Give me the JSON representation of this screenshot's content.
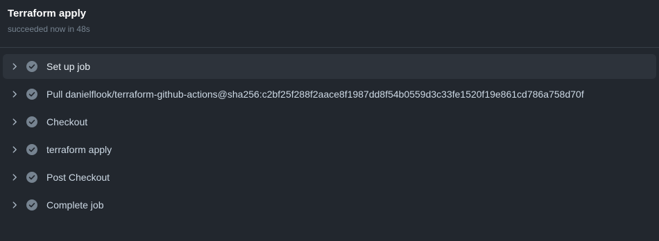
{
  "job": {
    "title": "Terraform apply",
    "status": "succeeded now in 48s"
  },
  "steps": [
    {
      "label": "Set up job",
      "status_icon": "check-circle-icon",
      "expand_icon": "chevron-right-icon"
    },
    {
      "label": "Pull danielflook/terraform-github-actions@sha256:c2bf25f288f2aace8f1987dd8f54b0559d3c33fe1520f19e861cd786a758d70f",
      "status_icon": "check-circle-icon",
      "expand_icon": "chevron-right-icon"
    },
    {
      "label": "Checkout",
      "status_icon": "check-circle-icon",
      "expand_icon": "chevron-right-icon"
    },
    {
      "label": "terraform apply",
      "status_icon": "check-circle-icon",
      "expand_icon": "chevron-right-icon"
    },
    {
      "label": "Post Checkout",
      "status_icon": "check-circle-icon",
      "expand_icon": "chevron-right-icon"
    },
    {
      "label": "Complete job",
      "status_icon": "check-circle-icon",
      "expand_icon": "chevron-right-icon"
    }
  ],
  "colors": {
    "background": "#22272e",
    "highlight_row": "#2d333b",
    "check_fill": "#768390",
    "text": "#cdd9e5",
    "muted_text": "#768390"
  }
}
